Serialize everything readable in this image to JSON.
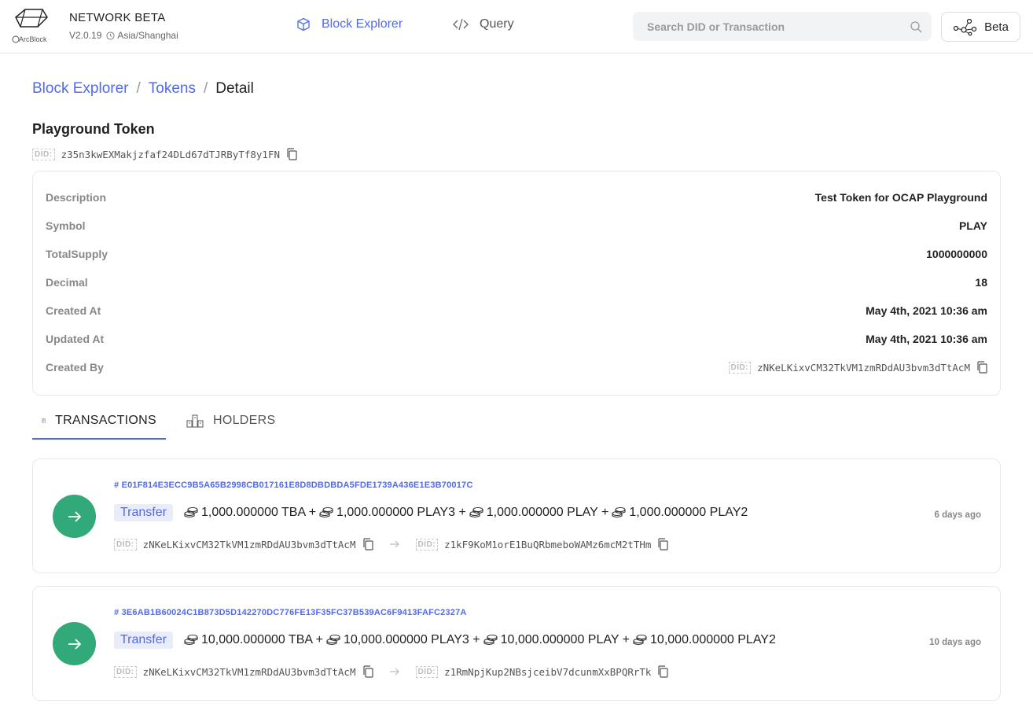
{
  "header": {
    "brand_title": "NETWORK BETA",
    "version": "V2.0.19",
    "timezone": "Asia/Shanghai",
    "logo_text": "ArcBlock",
    "nav": [
      {
        "label": "Block Explorer",
        "icon": "cube-icon",
        "active": true
      },
      {
        "label": "Query",
        "icon": "code-icon",
        "active": false
      }
    ],
    "search_placeholder": "Search DID or Transaction",
    "beta_label": "Beta"
  },
  "breadcrumb": [
    "Block Explorer",
    "Tokens",
    "Detail"
  ],
  "token": {
    "name": "Playground Token",
    "did_label": "DID:",
    "did": "z35n3kwEXMakjzfaf24DLd67dTJRByTf8y1FN",
    "details": [
      {
        "label": "Description",
        "value": "Test Token for OCAP Playground"
      },
      {
        "label": "Symbol",
        "value": "PLAY"
      },
      {
        "label": "TotalSupply",
        "value": "1000000000"
      },
      {
        "label": "Decimal",
        "value": "18"
      },
      {
        "label": "Created At",
        "value": "May 4th, 2021 10:36 am"
      },
      {
        "label": "Updated At",
        "value": "May 4th, 2021 10:36 am"
      }
    ],
    "created_by_label": "Created By",
    "created_by": "zNKeLKixvCM32TkVM1zmRDdAU3bvm3dTtAcM"
  },
  "tabs": [
    {
      "label": "TRANSACTIONS",
      "icon": "receipt-icon",
      "active": true
    },
    {
      "label": "HOLDERS",
      "icon": "holders-icon",
      "active": false
    }
  ],
  "transactions": [
    {
      "hash": "# E01F814E3ECC9B5A65B2998CB017161E8D8DBDBDA5FDE1739A436E1E3B70017C",
      "type": "Transfer",
      "amounts": [
        "1,000.000000 TBA +",
        "1,000.000000 PLAY3 +",
        "1,000.000000 PLAY +",
        "1,000.000000 PLAY2"
      ],
      "time": "6 days ago",
      "from": "zNKeLKixvCM32TkVM1zmRDdAU3bvm3dTtAcM",
      "to": "z1kF9KoM1orE1BuQRbmeboWAMz6mcM2tTHm"
    },
    {
      "hash": "# 3E6AB1B60024C1B873D5D142270DC776FE13F35FC37B539AC6F9413FAFC2327A",
      "type": "Transfer",
      "amounts": [
        "10,000.000000 TBA +",
        "10,000.000000 PLAY3 +",
        "10,000.000000 PLAY +",
        "10,000.000000 PLAY2"
      ],
      "time": "10 days ago",
      "from": "zNKeLKixvCM32TkVM1zmRDdAU3bvm3dTtAcM",
      "to": "z1RmNpjKup2NBsjceibV7dcunmXxBPQRrTk"
    }
  ],
  "colors": {
    "accent": "#4f6af0",
    "success": "#31a979"
  }
}
